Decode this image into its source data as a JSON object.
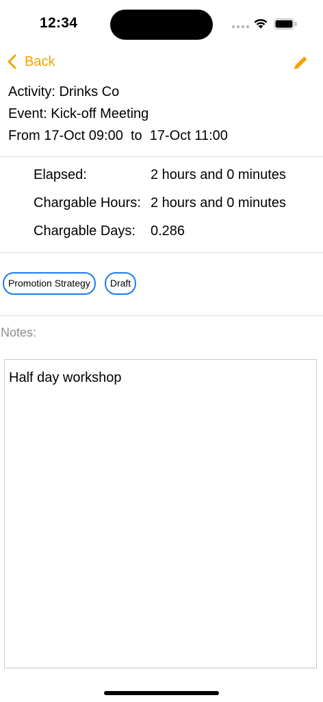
{
  "status_bar": {
    "time": "12:34",
    "icons": [
      "signal-dots-icon",
      "wifi-icon",
      "battery-icon"
    ]
  },
  "nav": {
    "back_label": "Back",
    "edit_icon": "pencil-icon",
    "accent_color": "#f4a300"
  },
  "info": {
    "activity": "Activity: Drinks Co",
    "event": "Event: Kick-off Meeting",
    "range": "From 17-Oct 09:00  to  17-Oct 11:00"
  },
  "stats": [
    {
      "label": "Elapsed:",
      "value": "2 hours and 0 minutes"
    },
    {
      "label": "Chargable Hours:",
      "value": "2 hours and 0 minutes"
    },
    {
      "label": "Chargable Days:",
      "value": "0.286"
    }
  ],
  "tags": [
    {
      "label": "Promotion Strategy"
    },
    {
      "label": "Draft"
    }
  ],
  "tag_color": "#1a7cf0",
  "notes": {
    "label": "Notes:",
    "text": "Half day workshop"
  }
}
